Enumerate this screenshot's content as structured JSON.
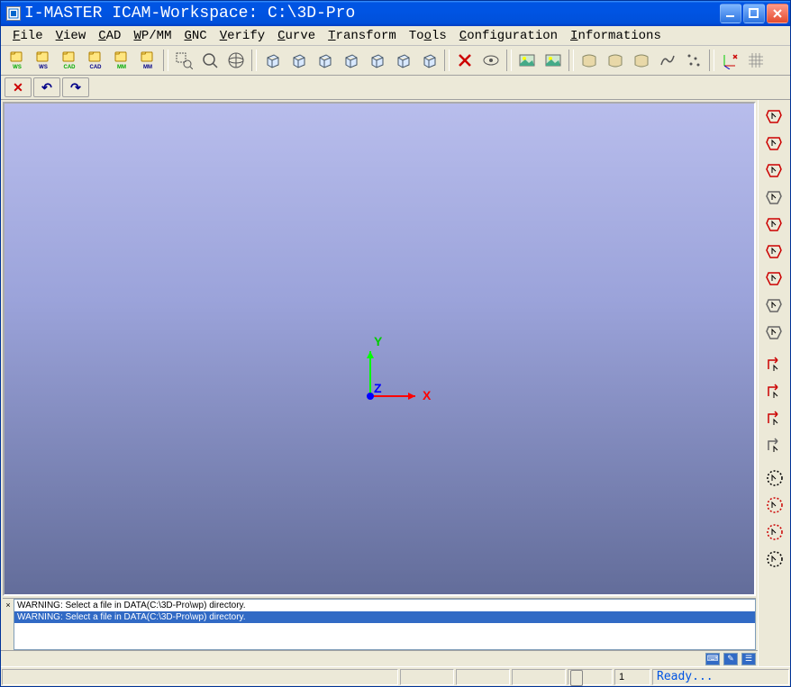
{
  "window": {
    "title": "I-MASTER ICAM-Workspace: C:\\3D-Pro"
  },
  "menubar": {
    "items": [
      {
        "label": "File",
        "ul": 0
      },
      {
        "label": "View",
        "ul": 0
      },
      {
        "label": "CAD",
        "ul": 0
      },
      {
        "label": "WP/MM",
        "ul": 0
      },
      {
        "label": "GNC",
        "ul": 0
      },
      {
        "label": "Verify",
        "ul": 0
      },
      {
        "label": "Curve",
        "ul": 0
      },
      {
        "label": "Transform",
        "ul": 0
      },
      {
        "label": "Tools",
        "ul": 2
      },
      {
        "label": "Configuration",
        "ul": 0
      },
      {
        "label": "Informations",
        "ul": 0
      }
    ]
  },
  "toolbar1": [
    {
      "name": "open-ws-icon",
      "sub": "WS",
      "color": "#0a0"
    },
    {
      "name": "save-ws-icon",
      "sub": "WS",
      "color": "#008"
    },
    {
      "name": "open-cad-icon",
      "sub": "CAD",
      "color": "#0a0"
    },
    {
      "name": "save-cad-icon",
      "sub": "CAD",
      "color": "#008"
    },
    {
      "name": "open-mm-icon",
      "sub": "MM",
      "color": "#0a0"
    },
    {
      "name": "save-mm-icon",
      "sub": "MM",
      "color": "#008"
    }
  ],
  "toolbar1b": [
    {
      "name": "zoom-window-icon"
    },
    {
      "name": "zoom-icon"
    },
    {
      "name": "zoom-globe-icon"
    }
  ],
  "toolbar1c": [
    {
      "name": "view-iso1-icon"
    },
    {
      "name": "view-iso2-icon"
    },
    {
      "name": "view-iso3-icon"
    },
    {
      "name": "view-iso4-icon"
    },
    {
      "name": "view-front-icon"
    },
    {
      "name": "view-side-icon"
    },
    {
      "name": "view-top-icon"
    }
  ],
  "toolbar1d": [
    {
      "name": "delete-x-icon",
      "color": "#c00"
    },
    {
      "name": "eye-icon"
    }
  ],
  "toolbar1e": [
    {
      "name": "image1-icon"
    },
    {
      "name": "image2-icon"
    }
  ],
  "toolbar1f": [
    {
      "name": "surface1-icon"
    },
    {
      "name": "surface2-icon"
    },
    {
      "name": "surface3-icon"
    },
    {
      "name": "curve-icon"
    },
    {
      "name": "points-icon"
    }
  ],
  "toolbar1g": [
    {
      "name": "axis-toggle-icon",
      "color": "#c00"
    },
    {
      "name": "grid-icon"
    }
  ],
  "toolbar2": [
    {
      "name": "cancel-x-icon",
      "glyph": "✕",
      "color": "#c00"
    },
    {
      "name": "undo-icon",
      "glyph": "↶",
      "color": "#008"
    },
    {
      "name": "redo-icon",
      "glyph": "↷",
      "color": "#008"
    }
  ],
  "axis": {
    "x": "X",
    "y": "Y",
    "z": "Z"
  },
  "right_toolbar": [
    {
      "name": "select-tool-1-icon",
      "color": "#c00"
    },
    {
      "name": "select-tool-2-icon",
      "color": "#c00"
    },
    {
      "name": "select-tool-3-icon",
      "color": "#c00"
    },
    {
      "name": "select-tool-4-icon",
      "color": "#666"
    },
    {
      "name": "select-tool-5-icon",
      "color": "#c00"
    },
    {
      "name": "select-tool-6-icon",
      "color": "#c00"
    },
    {
      "name": "select-tool-7-icon",
      "color": "#c00"
    },
    {
      "name": "select-tool-8-icon",
      "color": "#666"
    },
    {
      "name": "select-tool-9-icon",
      "color": "#666"
    },
    {
      "name": "arrow-tool-1-icon",
      "color": "#c00"
    },
    {
      "name": "arrow-tool-2-icon",
      "color": "#c00"
    },
    {
      "name": "arrow-tool-3-icon",
      "color": "#c00"
    },
    {
      "name": "arrow-tool-4-icon",
      "color": "#666"
    },
    {
      "name": "circle-dots-1-icon",
      "color": "#000"
    },
    {
      "name": "circle-dots-2-icon",
      "color": "#c00"
    },
    {
      "name": "circle-dots-3-icon",
      "color": "#c00"
    },
    {
      "name": "circle-dots-4-icon",
      "color": "#000"
    }
  ],
  "output": {
    "lines": [
      {
        "text": "WARNING: Select a file in DATA(C:\\3D-Pro\\wp) directory.",
        "selected": false
      },
      {
        "text": "WARNING: Select a file in DATA(C:\\3D-Pro\\wp) directory.",
        "selected": true
      }
    ]
  },
  "statusbar": {
    "value": "1",
    "ready": "Ready..."
  }
}
